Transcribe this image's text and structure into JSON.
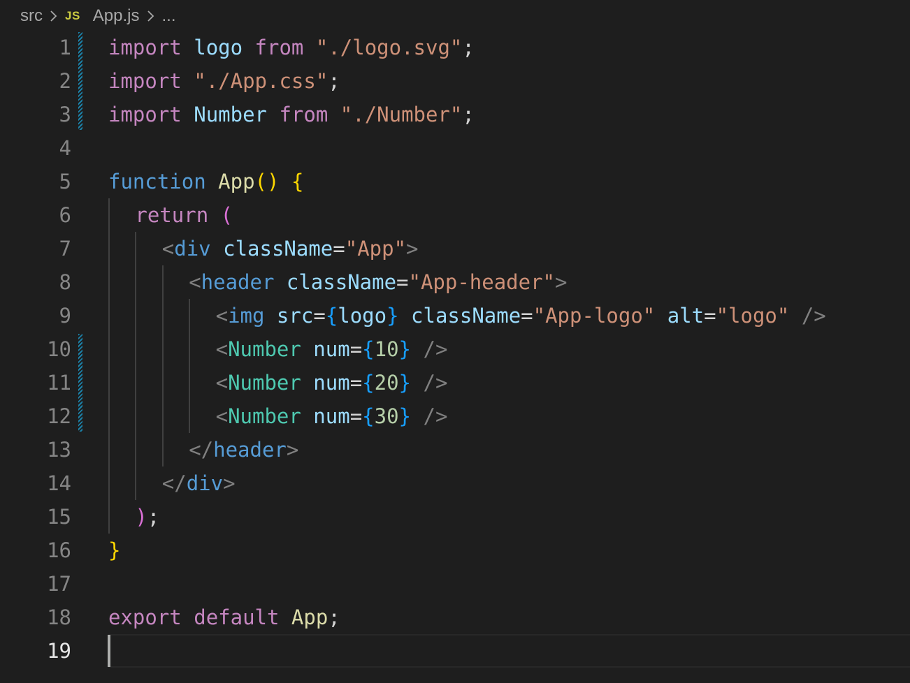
{
  "breadcrumb": {
    "folder": "src",
    "file_icon": "JS",
    "file": "App.js",
    "more": "..."
  },
  "colors": {
    "keyword": "#c586c0",
    "string": "#ce9178",
    "variable": "#9cdcfe",
    "storage": "#569cd6",
    "function": "#dcdcaa",
    "component": "#4ec9b0",
    "number": "#b5cea8",
    "punctuation": "#808080",
    "bracket_level1": "#ffd700",
    "bracket_level2": "#da70d6",
    "bracket_level3": "#179fff",
    "js_icon": "#cbcb41",
    "modified_gutter": "#1b81a8"
  },
  "editor": {
    "active_line": 19,
    "modified_lines": [
      1,
      2,
      3,
      10,
      11,
      12
    ],
    "lines": [
      {
        "n": "1",
        "indent": 0,
        "tokens": [
          {
            "t": "import",
            "c": "kw"
          },
          {
            "t": " ",
            "c": "def"
          },
          {
            "t": "logo",
            "c": "vr"
          },
          {
            "t": " ",
            "c": "def"
          },
          {
            "t": "from",
            "c": "kw"
          },
          {
            "t": " ",
            "c": "def"
          },
          {
            "t": "\"./logo.svg\"",
            "c": "st"
          },
          {
            "t": ";",
            "c": "def"
          }
        ]
      },
      {
        "n": "2",
        "indent": 0,
        "tokens": [
          {
            "t": "import",
            "c": "kw"
          },
          {
            "t": " ",
            "c": "def"
          },
          {
            "t": "\"./App.css\"",
            "c": "st"
          },
          {
            "t": ";",
            "c": "def"
          }
        ]
      },
      {
        "n": "3",
        "indent": 0,
        "tokens": [
          {
            "t": "import",
            "c": "kw"
          },
          {
            "t": " ",
            "c": "def"
          },
          {
            "t": "Number",
            "c": "vr"
          },
          {
            "t": " ",
            "c": "def"
          },
          {
            "t": "from",
            "c": "kw"
          },
          {
            "t": " ",
            "c": "def"
          },
          {
            "t": "\"./Number\"",
            "c": "st"
          },
          {
            "t": ";",
            "c": "def"
          }
        ]
      },
      {
        "n": "4",
        "indent": 0,
        "tokens": []
      },
      {
        "n": "5",
        "indent": 0,
        "tokens": [
          {
            "t": "function",
            "c": "sto"
          },
          {
            "t": " ",
            "c": "def"
          },
          {
            "t": "App",
            "c": "fn"
          },
          {
            "t": "()",
            "c": "b1"
          },
          {
            "t": " ",
            "c": "def"
          },
          {
            "t": "{",
            "c": "b1"
          }
        ]
      },
      {
        "n": "6",
        "indent": 1,
        "tokens": [
          {
            "t": "return",
            "c": "kw"
          },
          {
            "t": " ",
            "c": "def"
          },
          {
            "t": "(",
            "c": "b2"
          }
        ]
      },
      {
        "n": "7",
        "indent": 2,
        "tokens": [
          {
            "t": "<",
            "c": "punc"
          },
          {
            "t": "div",
            "c": "sto"
          },
          {
            "t": " ",
            "c": "def"
          },
          {
            "t": "className",
            "c": "vr"
          },
          {
            "t": "=",
            "c": "def"
          },
          {
            "t": "\"App\"",
            "c": "st"
          },
          {
            "t": ">",
            "c": "punc"
          }
        ]
      },
      {
        "n": "8",
        "indent": 3,
        "tokens": [
          {
            "t": "<",
            "c": "punc"
          },
          {
            "t": "header",
            "c": "sto"
          },
          {
            "t": " ",
            "c": "def"
          },
          {
            "t": "className",
            "c": "vr"
          },
          {
            "t": "=",
            "c": "def"
          },
          {
            "t": "\"App-header\"",
            "c": "st"
          },
          {
            "t": ">",
            "c": "punc"
          }
        ]
      },
      {
        "n": "9",
        "indent": 4,
        "tokens": [
          {
            "t": "<",
            "c": "punc"
          },
          {
            "t": "img",
            "c": "sto"
          },
          {
            "t": " ",
            "c": "def"
          },
          {
            "t": "src",
            "c": "vr"
          },
          {
            "t": "=",
            "c": "def"
          },
          {
            "t": "{",
            "c": "b3"
          },
          {
            "t": "logo",
            "c": "vr"
          },
          {
            "t": "}",
            "c": "b3"
          },
          {
            "t": " ",
            "c": "def"
          },
          {
            "t": "className",
            "c": "vr"
          },
          {
            "t": "=",
            "c": "def"
          },
          {
            "t": "\"App-logo\"",
            "c": "st"
          },
          {
            "t": " ",
            "c": "def"
          },
          {
            "t": "alt",
            "c": "vr"
          },
          {
            "t": "=",
            "c": "def"
          },
          {
            "t": "\"logo\"",
            "c": "st"
          },
          {
            "t": " ",
            "c": "def"
          },
          {
            "t": "/>",
            "c": "punc"
          }
        ]
      },
      {
        "n": "10",
        "indent": 4,
        "tokens": [
          {
            "t": "<",
            "c": "punc"
          },
          {
            "t": "Number",
            "c": "cmp"
          },
          {
            "t": " ",
            "c": "def"
          },
          {
            "t": "num",
            "c": "vr"
          },
          {
            "t": "=",
            "c": "def"
          },
          {
            "t": "{",
            "c": "b3"
          },
          {
            "t": "10",
            "c": "num"
          },
          {
            "t": "}",
            "c": "b3"
          },
          {
            "t": " ",
            "c": "def"
          },
          {
            "t": "/>",
            "c": "punc"
          }
        ]
      },
      {
        "n": "11",
        "indent": 4,
        "tokens": [
          {
            "t": "<",
            "c": "punc"
          },
          {
            "t": "Number",
            "c": "cmp"
          },
          {
            "t": " ",
            "c": "def"
          },
          {
            "t": "num",
            "c": "vr"
          },
          {
            "t": "=",
            "c": "def"
          },
          {
            "t": "{",
            "c": "b3"
          },
          {
            "t": "20",
            "c": "num"
          },
          {
            "t": "}",
            "c": "b3"
          },
          {
            "t": " ",
            "c": "def"
          },
          {
            "t": "/>",
            "c": "punc"
          }
        ]
      },
      {
        "n": "12",
        "indent": 4,
        "tokens": [
          {
            "t": "<",
            "c": "punc"
          },
          {
            "t": "Number",
            "c": "cmp"
          },
          {
            "t": " ",
            "c": "def"
          },
          {
            "t": "num",
            "c": "vr"
          },
          {
            "t": "=",
            "c": "def"
          },
          {
            "t": "{",
            "c": "b3"
          },
          {
            "t": "30",
            "c": "num"
          },
          {
            "t": "}",
            "c": "b3"
          },
          {
            "t": " ",
            "c": "def"
          },
          {
            "t": "/>",
            "c": "punc"
          }
        ]
      },
      {
        "n": "13",
        "indent": 3,
        "tokens": [
          {
            "t": "</",
            "c": "punc"
          },
          {
            "t": "header",
            "c": "sto"
          },
          {
            "t": ">",
            "c": "punc"
          }
        ]
      },
      {
        "n": "14",
        "indent": 2,
        "tokens": [
          {
            "t": "</",
            "c": "punc"
          },
          {
            "t": "div",
            "c": "sto"
          },
          {
            "t": ">",
            "c": "punc"
          }
        ]
      },
      {
        "n": "15",
        "indent": 1,
        "tokens": [
          {
            "t": ")",
            "c": "b2"
          },
          {
            "t": ";",
            "c": "def"
          }
        ]
      },
      {
        "n": "16",
        "indent": 0,
        "tokens": [
          {
            "t": "}",
            "c": "b1"
          }
        ]
      },
      {
        "n": "17",
        "indent": 0,
        "tokens": []
      },
      {
        "n": "18",
        "indent": 0,
        "tokens": [
          {
            "t": "export",
            "c": "kw"
          },
          {
            "t": " ",
            "c": "def"
          },
          {
            "t": "default",
            "c": "kw"
          },
          {
            "t": " ",
            "c": "def"
          },
          {
            "t": "App",
            "c": "fn"
          },
          {
            "t": ";",
            "c": "def"
          }
        ]
      },
      {
        "n": "19",
        "indent": 0,
        "tokens": []
      }
    ]
  }
}
